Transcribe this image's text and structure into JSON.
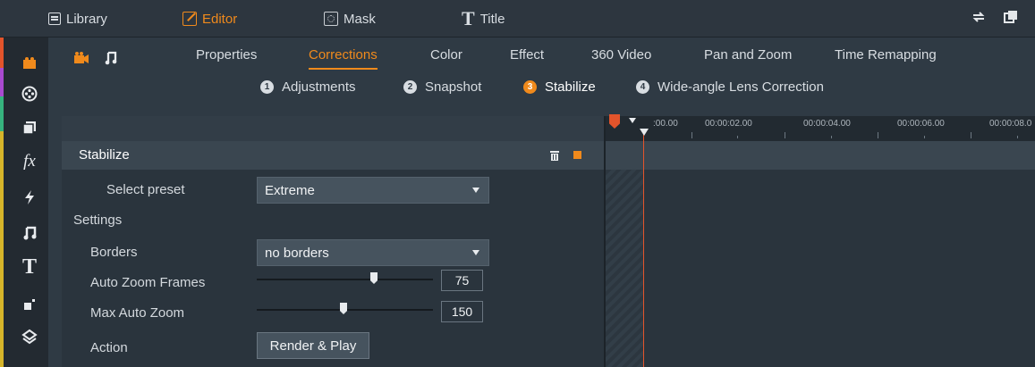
{
  "topnav": {
    "library": "Library",
    "editor": "Editor",
    "mask": "Mask",
    "title": "Title",
    "icons": [
      "swap-icon",
      "popout-icon"
    ]
  },
  "sidebar": {
    "icons": [
      "video-icon",
      "film-reel-icon",
      "library-stack-icon",
      "fx-icon",
      "lightning-icon",
      "music-icon",
      "title-icon",
      "transition-icon",
      "layers-icon"
    ],
    "fx_text": "fx",
    "t_text": "T"
  },
  "tabs": {
    "items": [
      "Properties",
      "Corrections",
      "Color",
      "Effect",
      "360 Video",
      "Pan and Zoom",
      "Time Remapping"
    ],
    "active": "Corrections"
  },
  "subtabs": {
    "items": [
      {
        "num": "1",
        "label": "Adjustments"
      },
      {
        "num": "2",
        "label": "Snapshot"
      },
      {
        "num": "3",
        "label": "Stabilize"
      },
      {
        "num": "4",
        "label": "Wide-angle Lens Correction"
      }
    ],
    "active": "Stabilize"
  },
  "section": {
    "title": "Stabilize",
    "select_preset_label": "Select preset",
    "select_preset_value": "Extreme",
    "settings_label": "Settings",
    "borders_label": "Borders",
    "borders_value": "no borders",
    "auto_zoom_label": "Auto Zoom Frames",
    "auto_zoom_value": "75",
    "max_zoom_label": "Max Auto Zoom",
    "max_zoom_value": "150",
    "action_label": "Action",
    "action_button": "Render & Play"
  },
  "timeline": {
    "ticks": [
      ":00.00",
      "00:00:02.00",
      "00:00:04.00",
      "00:00:06.00",
      "00:00:08.0"
    ]
  },
  "colors": {
    "accent": "#f08a1c",
    "playhead": "#e3542b"
  }
}
